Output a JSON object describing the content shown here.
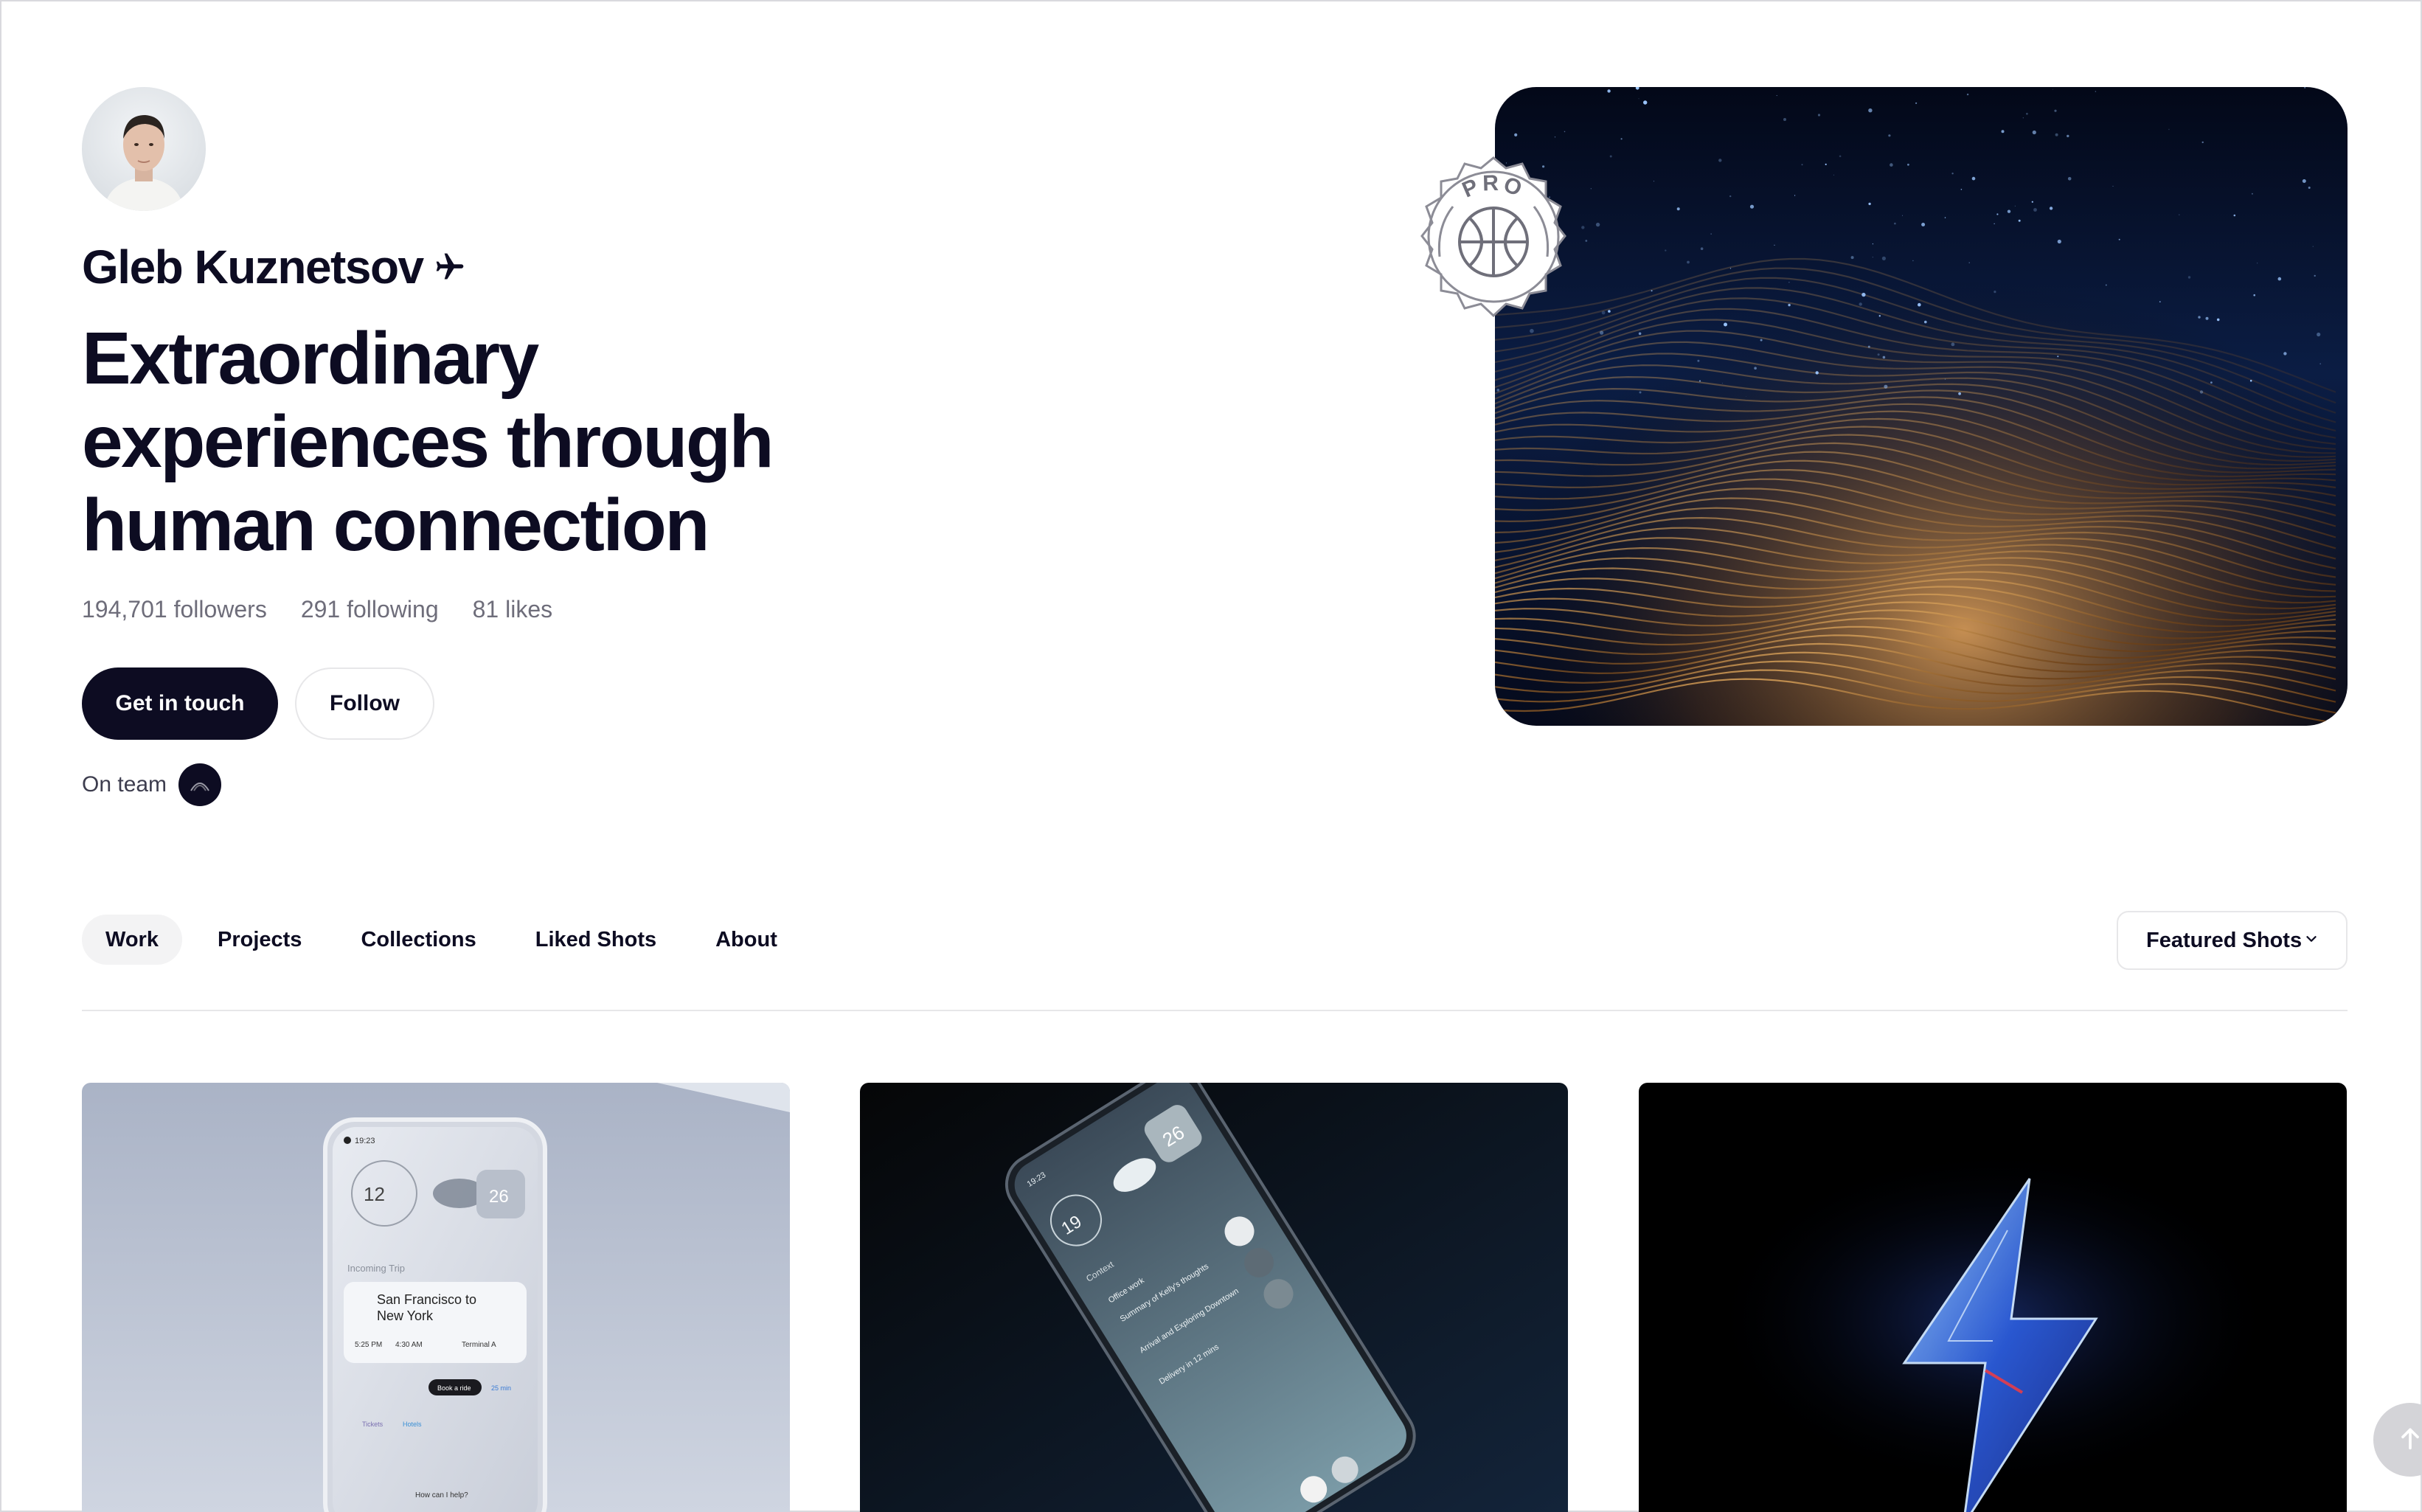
{
  "profile": {
    "name": "Gleb Kuznetsov",
    "headline": [
      "Extraordinary",
      "experiences through",
      "human connection"
    ],
    "stats": {
      "followers": "194,701 followers",
      "following": "291 following",
      "likes": "81 likes"
    },
    "primary_button": "Get in touch",
    "secondary_button": "Follow",
    "team_label": "On team",
    "badge_text": "PRO"
  },
  "tabs": [
    {
      "label": "Work",
      "active": true
    },
    {
      "label": "Projects",
      "active": false
    },
    {
      "label": "Collections",
      "active": false
    },
    {
      "label": "Liked Shots",
      "active": false
    },
    {
      "label": "About",
      "active": false
    }
  ],
  "sort": {
    "selected": "Featured Shots"
  },
  "shots": [
    {
      "alt": "Light phone mockup",
      "phone": {
        "status_time": "19:23",
        "clock": "12",
        "temp": "26",
        "section": "Incoming Trip",
        "trip_title_1": "San Francisco to",
        "trip_title_2": "New York",
        "depart": "5:25 PM",
        "arrive": "4:30 AM",
        "terminal": "Terminal A",
        "cta": "Book a ride",
        "eta": "25 min",
        "chip_1": "Tickets",
        "chip_2": "Hotels",
        "help": "How can I help?"
      }
    },
    {
      "alt": "Dark phone mockup",
      "phone": {
        "status_time": "19:23",
        "clock": "19",
        "temp": "26",
        "section": "Context",
        "line_1": "Office work",
        "line_2": "Summary of Kelly's thoughts",
        "line_3": "Arrival and Exploring Downtown",
        "line_4": "Delivery in 12 mins"
      }
    },
    {
      "alt": "Glass lightning bolt"
    }
  ],
  "colors": {
    "ink": "#0d0c22",
    "muted": "#6e6d7a",
    "border": "#e7e7e9",
    "tab_active_bg": "#f3f3f4"
  },
  "icons": [
    "plane-icon",
    "chevron-down-icon",
    "arrow-up-icon",
    "basketball-icon"
  ]
}
